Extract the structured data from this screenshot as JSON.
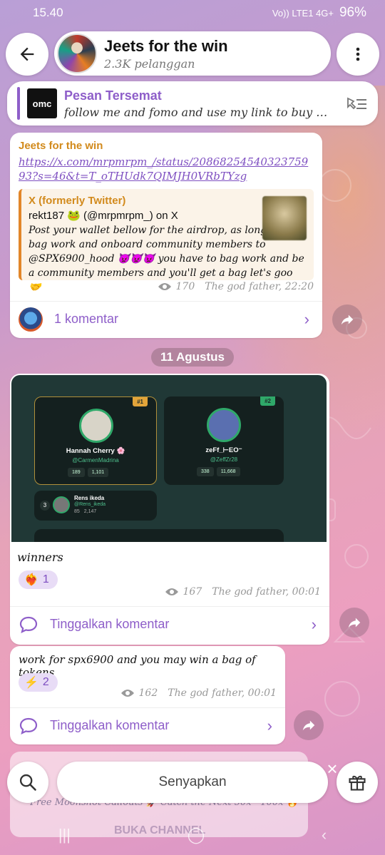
{
  "status_bar": {
    "time": "15.40",
    "signal_labels": "Vo)) LTE1  4G+",
    "battery": "96%"
  },
  "header": {
    "channel_title": "Jeets for the win",
    "subscribers": "2.3K pelanggan"
  },
  "pinned": {
    "label": "Pesan Tersemat",
    "thumb_text": "omc",
    "preview": "follow me and fomo and use my link to buy #..."
  },
  "messages": [
    {
      "sender": "Jeets for the win",
      "link": "https://x.com/mrpmrpm_/status/2086825454032375993?s=46&t=T_oTHUdk7QIMJH0VRbTYzg",
      "preview": {
        "site": "X (formerly Twitter)",
        "title": "rekt187 🐸 (@mrpmrpm_) on X",
        "desc": "Post your wallet bellow for the airdrop, as long as you bag work and onboard community members to @SPX6900_hood 👿👿👿 you have to bag work and be a community members and you'll get a bag let's goo 🤝"
      },
      "views": "170",
      "author_time": "The god father, 22:20",
      "comments_label": "1 komentar"
    },
    {
      "date_divider": "11 Agustus",
      "leaderboard": {
        "entries": [
          {
            "rank": "#1",
            "name": "Hannah Cherry 🌸",
            "handle": "@CarmenMadrina",
            "stat1": "189",
            "stat2": "1,101"
          },
          {
            "rank": "#2",
            "name": "zeFf_⊢EO⁻",
            "handle": "@ZeffZr28",
            "stat1": "338",
            "stat2": "11,668"
          },
          {
            "rank": "3",
            "name": "Rens ikeda",
            "handle": "@Rens_ikeda",
            "stat1": "85",
            "stat2": "2,147"
          }
        ]
      },
      "caption": "winners",
      "reaction_emoji": "❤️‍🔥",
      "reaction_count": "1",
      "views": "167",
      "author_time": "The god father, 00:01",
      "comments_label": "Tinggalkan komentar"
    },
    {
      "text": "work for spx6900 and you may win a bag of tokens",
      "reaction_emoji": "⚡",
      "reaction_count": "2",
      "views": "162",
      "author_time": "The god father, 00:01",
      "comments_label": "Tinggalkan komentar"
    }
  ],
  "bottom": {
    "mute_label": "Senyapkan",
    "under_text": "Free Moonshot Callouts 🚀 Catch the Next 50x - 100x 🔥",
    "open_channel": "BUKA CHANNEL"
  },
  "colors": {
    "accent": "#8e5ec9",
    "sender": "#d28a1c",
    "link": "#7e4fc1"
  },
  "icons": [
    "back-arrow-icon",
    "more-vert-icon",
    "pin-list-icon",
    "eye-icon",
    "share-icon",
    "comment-icon",
    "chevron-right-icon",
    "search-icon",
    "gift-icon",
    "close-icon"
  ]
}
